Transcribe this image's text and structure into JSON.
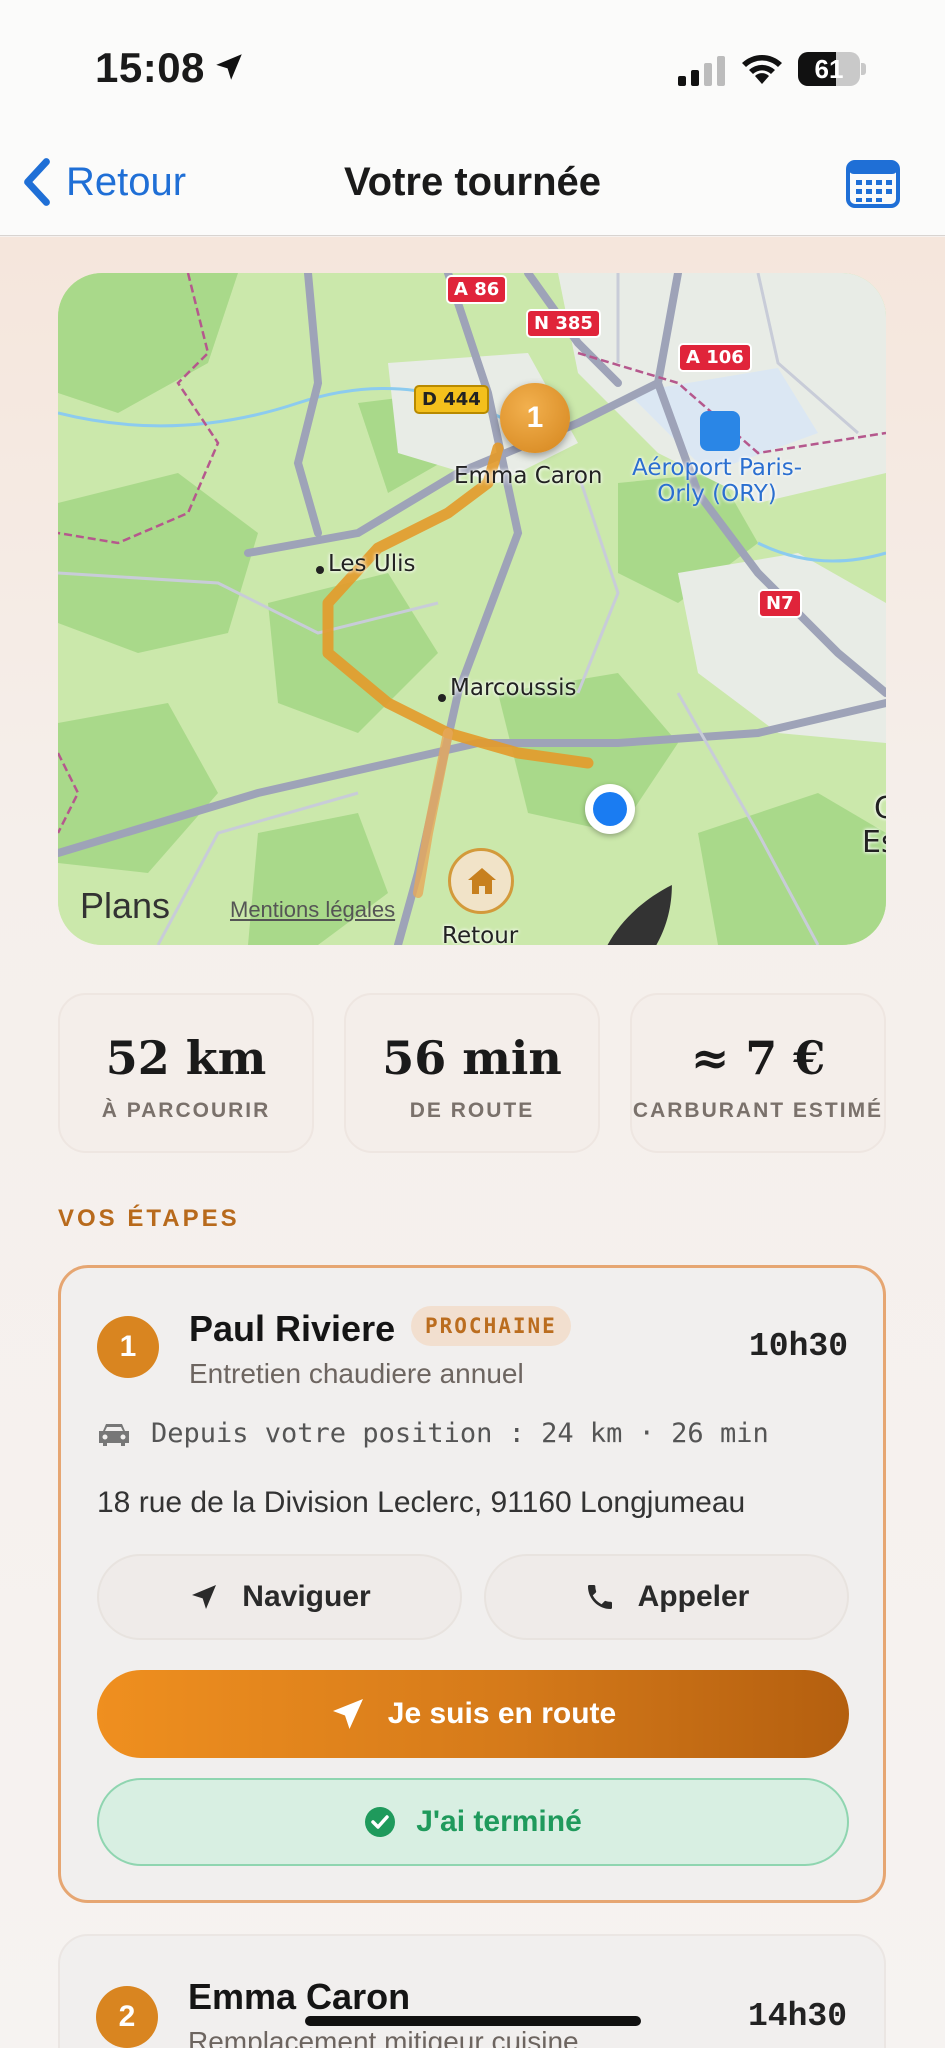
{
  "status_bar": {
    "time": "15:08",
    "battery": "61",
    "battery_level": 0.61
  },
  "nav": {
    "back_label": "Retour",
    "title": "Votre tournée",
    "calendar_icon": "calendar-icon"
  },
  "map": {
    "labels": {
      "emma": "Emma Caron",
      "ulis": "Les Ulis",
      "marcoussis": "Marcoussis",
      "airport_line1": "Aéroport Paris-",
      "airport_line2": "Orly (ORY)",
      "retour": "Retour",
      "edge": "C",
      "edge2": "Es"
    },
    "shields": {
      "a86": "A 86",
      "n385": "N 385",
      "a106": "A 106",
      "d444": "D 444",
      "n7": "N7"
    },
    "pin_number": "1",
    "plans": "Plans",
    "legal": "Mentions légales"
  },
  "stats": [
    {
      "value": "52 km",
      "label": "À PARCOURIR"
    },
    {
      "value": "56 min",
      "label": "DE ROUTE"
    },
    {
      "value": "≈ 7 €",
      "label": "CARBURANT ESTIMÉ"
    }
  ],
  "section_title": "VOS ÉTAPES",
  "stops": [
    {
      "number": "1",
      "name": "Paul Riviere",
      "badge": "PROCHAINE",
      "time": "10h30",
      "service": "Entretien chaudiere annuel",
      "distance": "Depuis votre position : 24 km · 26 min",
      "address": "18 rue de la Division Leclerc, 91160 Longjumeau",
      "navigate_label": "Naviguer",
      "call_label": "Appeler",
      "en_route_label": "Je suis en route",
      "done_label": "J'ai terminé"
    },
    {
      "number": "2",
      "name": "Emma Caron",
      "time": "14h30",
      "service": "Remplacement mitigeur cuisine"
    }
  ],
  "colors": {
    "accent": "#d98520",
    "link": "#1f6fd6",
    "success": "#1f9a5c",
    "route": "#e39a2a"
  }
}
